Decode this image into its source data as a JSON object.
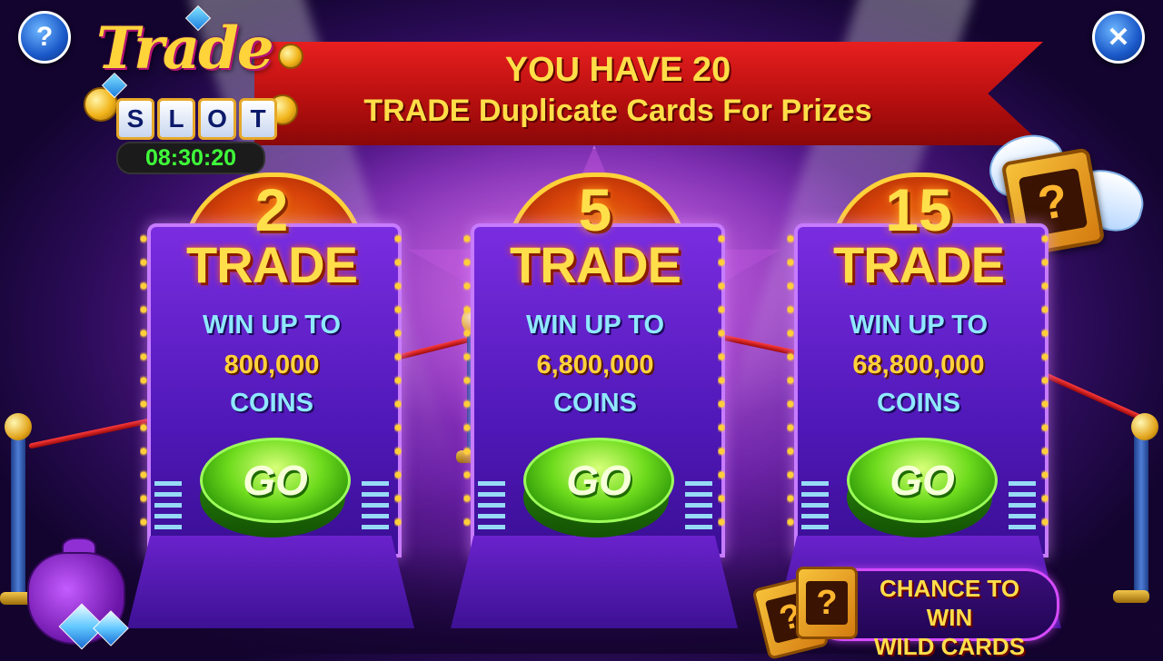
{
  "top_controls": {
    "help_symbol": "?",
    "close_symbol": "✕"
  },
  "logo": {
    "title": "Trade",
    "slot_letters": [
      "S",
      "L",
      "O",
      "T"
    ],
    "timer": "08:30:20"
  },
  "banner": {
    "line1": "YOU HAVE 20",
    "line2": "TRADE Duplicate Cards For Prizes"
  },
  "mystery_card_symbol": "?",
  "machines": [
    {
      "count": "2",
      "trade_label": "TRADE",
      "win_label": "WIN UP TO",
      "amount": "800,000",
      "unit": "COINS",
      "button": "GO"
    },
    {
      "count": "5",
      "trade_label": "TRADE",
      "win_label": "WIN UP TO",
      "amount": "6,800,000",
      "unit": "COINS",
      "button": "GO"
    },
    {
      "count": "15",
      "trade_label": "TRADE",
      "win_label": "WIN UP TO",
      "amount": "68,800,000",
      "unit": "COINS",
      "button": "GO"
    }
  ],
  "wild_cards": {
    "line1": "CHANCE TO WIN",
    "line2": "WILD CARDS",
    "card_symbol": "?"
  },
  "colors": {
    "banner_red": "#c81414",
    "gold_text": "#ffde48",
    "go_green": "#6fdc1e",
    "accent_purple": "#7a2de0"
  }
}
